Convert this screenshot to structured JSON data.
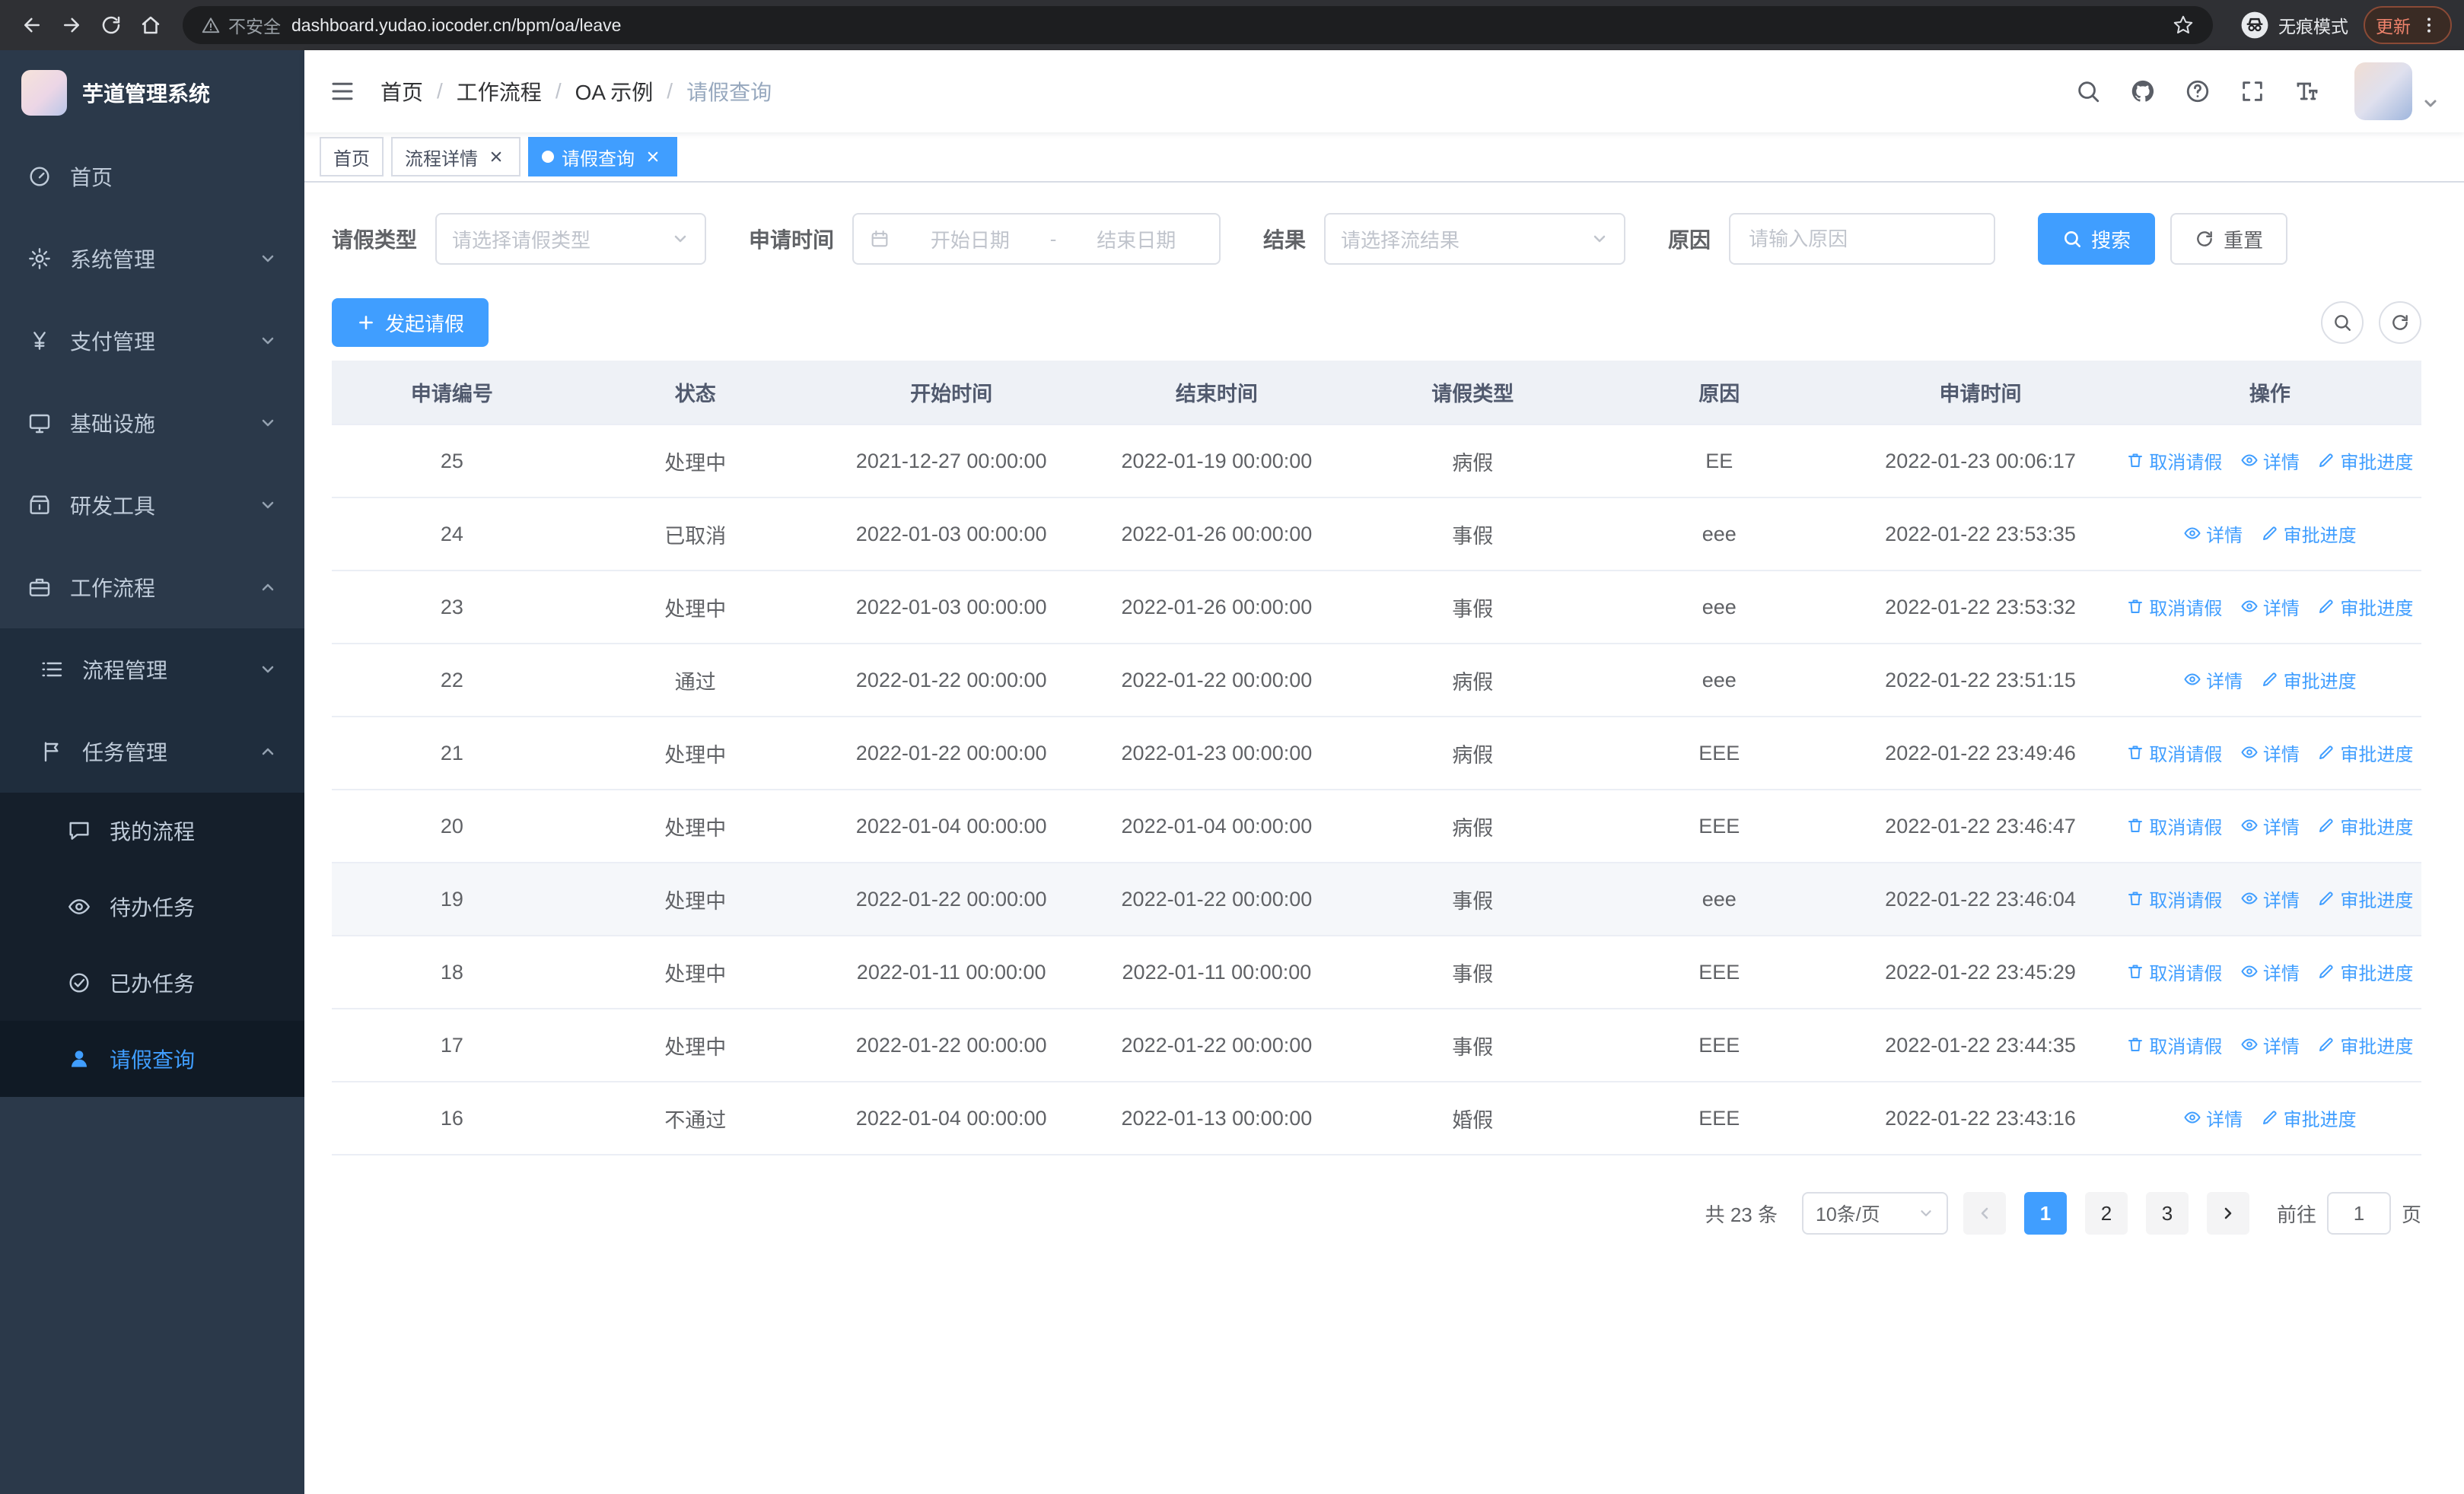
{
  "browser": {
    "security_label": "不安全",
    "url": "dashboard.yudao.iocoder.cn/bpm/oa/leave",
    "incognito_label": "无痕模式",
    "update_label": "更新"
  },
  "sidebar": {
    "logo_title": "芋道管理系统",
    "items": [
      {
        "label": "首页"
      },
      {
        "label": "系统管理"
      },
      {
        "label": "支付管理"
      },
      {
        "label": "基础设施"
      },
      {
        "label": "研发工具"
      },
      {
        "label": "工作流程"
      }
    ],
    "workflow_children": [
      {
        "label": "流程管理"
      },
      {
        "label": "任务管理"
      }
    ],
    "task_children": [
      {
        "label": "我的流程"
      },
      {
        "label": "待办任务"
      },
      {
        "label": "已办任务"
      },
      {
        "label": "请假查询"
      }
    ]
  },
  "header": {
    "breadcrumb": [
      "首页",
      "工作流程",
      "OA 示例",
      "请假查询"
    ],
    "separator": "/"
  },
  "tabs": [
    {
      "label": "首页"
    },
    {
      "label": "流程详情"
    },
    {
      "label": "请假查询"
    }
  ],
  "filters": {
    "leave_type_label": "请假类型",
    "leave_type_placeholder": "请选择请假类型",
    "apply_time_label": "申请时间",
    "start_date_placeholder": "开始日期",
    "date_separator": "-",
    "end_date_placeholder": "结束日期",
    "result_label": "结果",
    "result_placeholder": "请选择流结果",
    "reason_label": "原因",
    "reason_placeholder": "请输入原因",
    "search_button": "搜索",
    "reset_button": "重置"
  },
  "toolbar": {
    "create_button": "发起请假"
  },
  "table": {
    "columns": [
      "申请编号",
      "状态",
      "开始时间",
      "结束时间",
      "请假类型",
      "原因",
      "申请时间",
      "操作"
    ],
    "action_labels": {
      "cancel": "取消请假",
      "detail": "详情",
      "progress": "审批进度"
    },
    "rows": [
      {
        "id": "25",
        "status": "处理中",
        "start": "2021-12-27 00:00:00",
        "end": "2022-01-19 00:00:00",
        "type": "病假",
        "reason": "EE",
        "applied": "2022-01-23 00:06:17",
        "cancellable": true
      },
      {
        "id": "24",
        "status": "已取消",
        "start": "2022-01-03 00:00:00",
        "end": "2022-01-26 00:00:00",
        "type": "事假",
        "reason": "eee",
        "applied": "2022-01-22 23:53:35",
        "cancellable": false
      },
      {
        "id": "23",
        "status": "处理中",
        "start": "2022-01-03 00:00:00",
        "end": "2022-01-26 00:00:00",
        "type": "事假",
        "reason": "eee",
        "applied": "2022-01-22 23:53:32",
        "cancellable": true
      },
      {
        "id": "22",
        "status": "通过",
        "start": "2022-01-22 00:00:00",
        "end": "2022-01-22 00:00:00",
        "type": "病假",
        "reason": "eee",
        "applied": "2022-01-22 23:51:15",
        "cancellable": false
      },
      {
        "id": "21",
        "status": "处理中",
        "start": "2022-01-22 00:00:00",
        "end": "2022-01-23 00:00:00",
        "type": "病假",
        "reason": "EEE",
        "applied": "2022-01-22 23:49:46",
        "cancellable": true
      },
      {
        "id": "20",
        "status": "处理中",
        "start": "2022-01-04 00:00:00",
        "end": "2022-01-04 00:00:00",
        "type": "病假",
        "reason": "EEE",
        "applied": "2022-01-22 23:46:47",
        "cancellable": true
      },
      {
        "id": "19",
        "status": "处理中",
        "start": "2022-01-22 00:00:00",
        "end": "2022-01-22 00:00:00",
        "type": "事假",
        "reason": "eee",
        "applied": "2022-01-22 23:46:04",
        "cancellable": true,
        "highlighted": true
      },
      {
        "id": "18",
        "status": "处理中",
        "start": "2022-01-11 00:00:00",
        "end": "2022-01-11 00:00:00",
        "type": "事假",
        "reason": "EEE",
        "applied": "2022-01-22 23:45:29",
        "cancellable": true
      },
      {
        "id": "17",
        "status": "处理中",
        "start": "2022-01-22 00:00:00",
        "end": "2022-01-22 00:00:00",
        "type": "事假",
        "reason": "EEE",
        "applied": "2022-01-22 23:44:35",
        "cancellable": true
      },
      {
        "id": "16",
        "status": "不通过",
        "start": "2022-01-04 00:00:00",
        "end": "2022-01-13 00:00:00",
        "type": "婚假",
        "reason": "EEE",
        "applied": "2022-01-22 23:43:16",
        "cancellable": false
      }
    ]
  },
  "pagination": {
    "total_text": "共 23 条",
    "page_size": "10条/页",
    "pages": [
      "1",
      "2",
      "3"
    ],
    "active_page": "1",
    "goto_label": "前往",
    "goto_value": "1",
    "goto_suffix": "页"
  }
}
